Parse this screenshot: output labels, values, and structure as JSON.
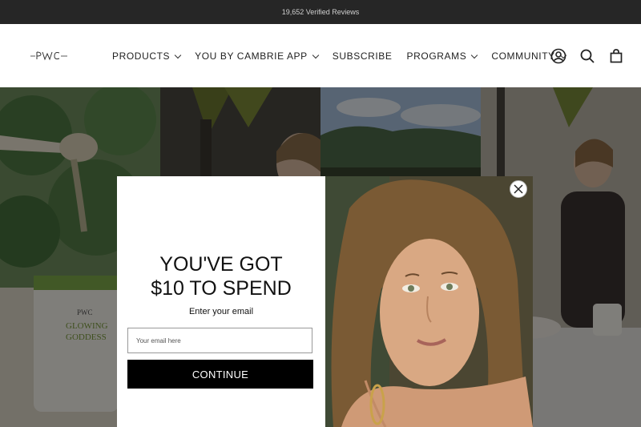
{
  "announcement": {
    "text": "19,652 Verified Reviews"
  },
  "header": {
    "logo_text": "PWC",
    "nav": [
      {
        "label": "PRODUCTS",
        "dropdown": true
      },
      {
        "label": "YOU BY CAMBRIE APP",
        "dropdown": true
      },
      {
        "label": "SUBSCRIBE",
        "dropdown": false
      },
      {
        "label": "PROGRAMS",
        "dropdown": true
      },
      {
        "label": "COMMUNITY",
        "dropdown": true
      }
    ],
    "icons": [
      "account-icon",
      "search-icon",
      "cart-icon"
    ]
  },
  "background": {
    "product_label_brand": "PWC",
    "product_label_name_1": "GLOWING",
    "product_label_name_2": "GODDESS"
  },
  "popup": {
    "headline_line1": "YOU'VE GOT",
    "headline_line2": "$10 TO SPEND",
    "subtext": "Enter your email",
    "email_placeholder": "Your email here",
    "button_label": "CONTINUE"
  },
  "colors": {
    "announcement_bg": "#262626",
    "button_bg": "#000000",
    "overlay": "rgba(0,0,0,0.48)"
  }
}
